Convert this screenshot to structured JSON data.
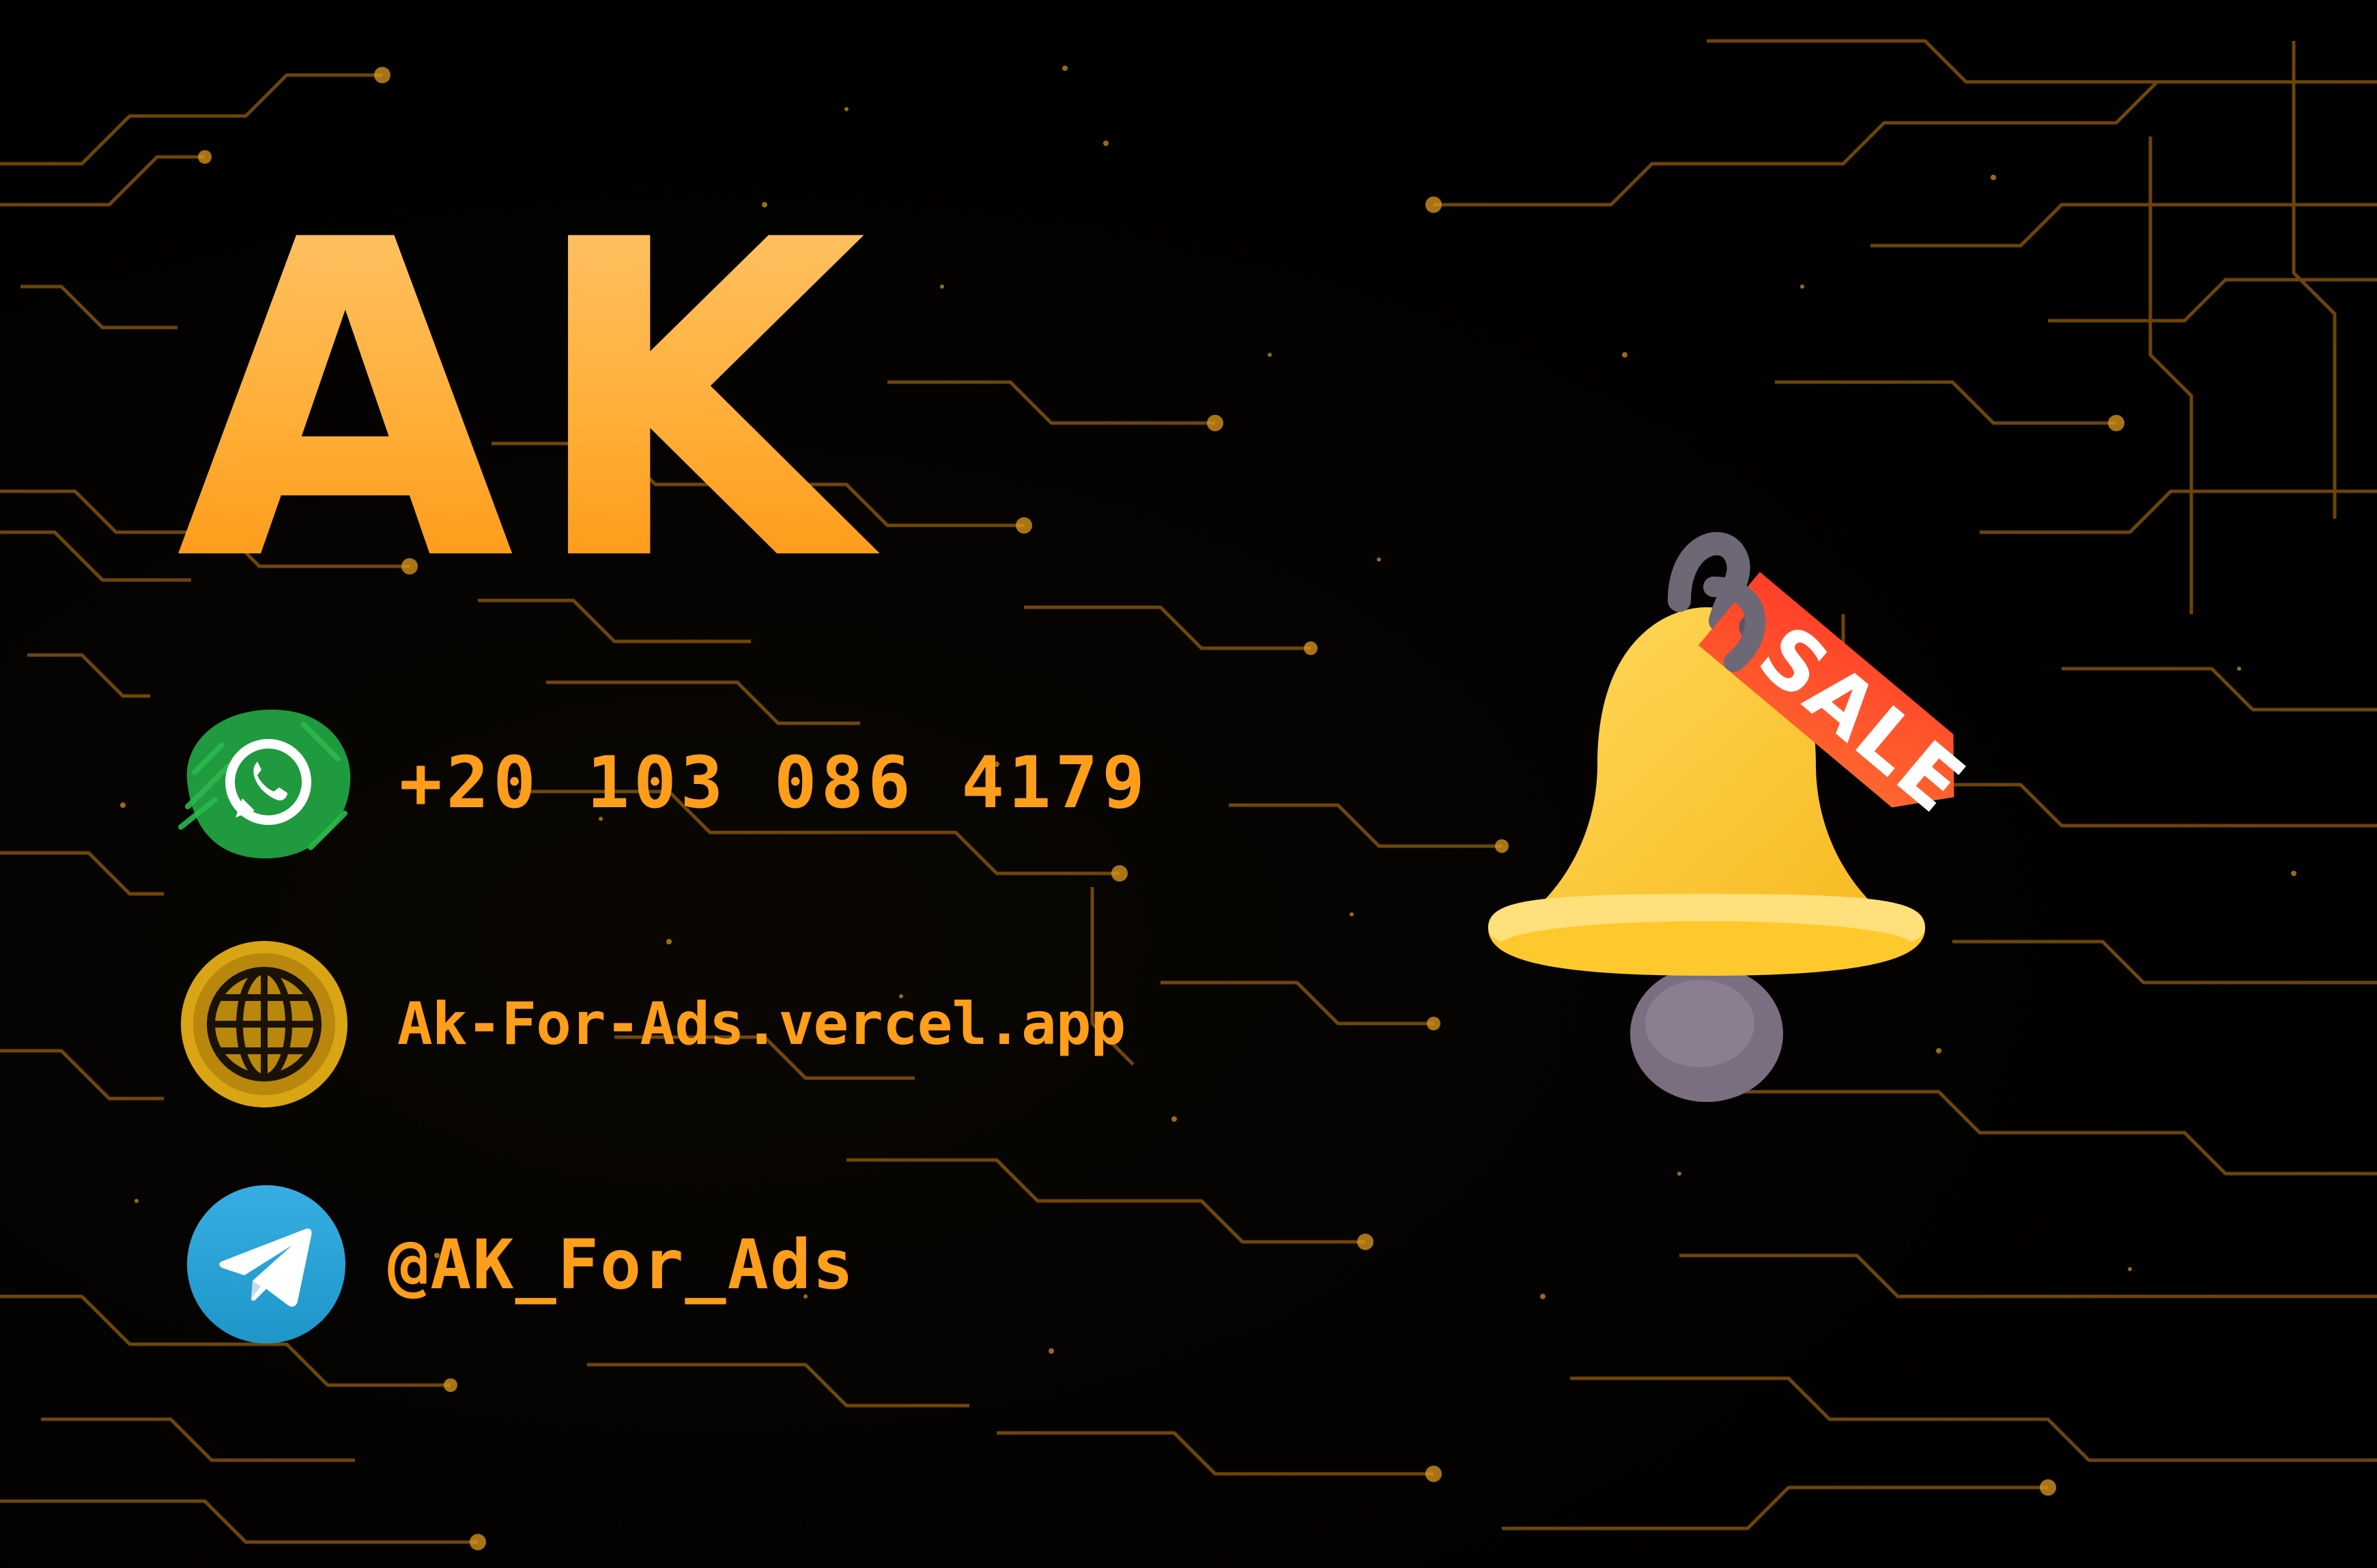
{
  "logo": {
    "text": "AK"
  },
  "contacts": {
    "whatsapp": {
      "icon": "whatsapp-icon",
      "text": "+20 103 086 4179"
    },
    "website": {
      "icon": "globe-icon",
      "text": "Ak-For-Ads.vercel.app"
    },
    "telegram": {
      "icon": "telegram-icon",
      "text": "@AK_For_Ads"
    }
  },
  "illustration": {
    "icon": "sale-bell-icon",
    "tag_text": "SALE"
  },
  "colors": {
    "background": "#000000",
    "accent": "#ff9e1a",
    "circuit": "#d98a14",
    "whatsapp_green": "#25a244",
    "globe_gold": "#d9a514",
    "telegram_blue": "#2aa3e0",
    "bell_yellow": "#ffcf3a",
    "tag_red": "#ff4a2a"
  }
}
